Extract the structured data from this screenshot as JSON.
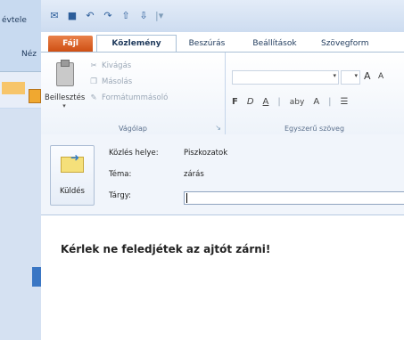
{
  "background_window": {
    "title_fragment": "évtele",
    "tab_fragment": "Néz"
  },
  "quick_access": {
    "icons": [
      "outlook-icon",
      "save-icon",
      "undo-icon",
      "redo-icon",
      "up-arrow-icon",
      "down-arrow-icon",
      "customize-icon"
    ]
  },
  "tabs": {
    "file": "Fájl",
    "message": "Közlemény",
    "insert": "Beszúrás",
    "settings": "Beállítások",
    "format": "Szövegform"
  },
  "ribbon": {
    "clipboard": {
      "paste": "Beillesztés",
      "cut": "Kivágás",
      "copy": "Másolás",
      "format_painter": "Formátummásoló",
      "group_label": "Vágólap"
    },
    "basic_text": {
      "font_value": "",
      "size_value": "",
      "grow_font": "A",
      "shrink_font": "A",
      "bold": "F",
      "italic": "D",
      "underline": "A",
      "highlight": "aby",
      "font_color": "A",
      "group_label": "Egyszerű szöveg"
    }
  },
  "header": {
    "send": "Küldés",
    "location_label": "Közlés helye:",
    "location_value": "Piszkozatok",
    "topic_label": "Téma:",
    "topic_value": "zárás",
    "subject_label": "Tárgy:",
    "subject_value": ""
  },
  "body": {
    "text": "Kérlek ne feledjétek az ajtót zárni!"
  },
  "colors": {
    "file_tab": "#cf4f13",
    "ribbon_border": "#a9bfd6",
    "header_bg": "#f1f5fb"
  }
}
